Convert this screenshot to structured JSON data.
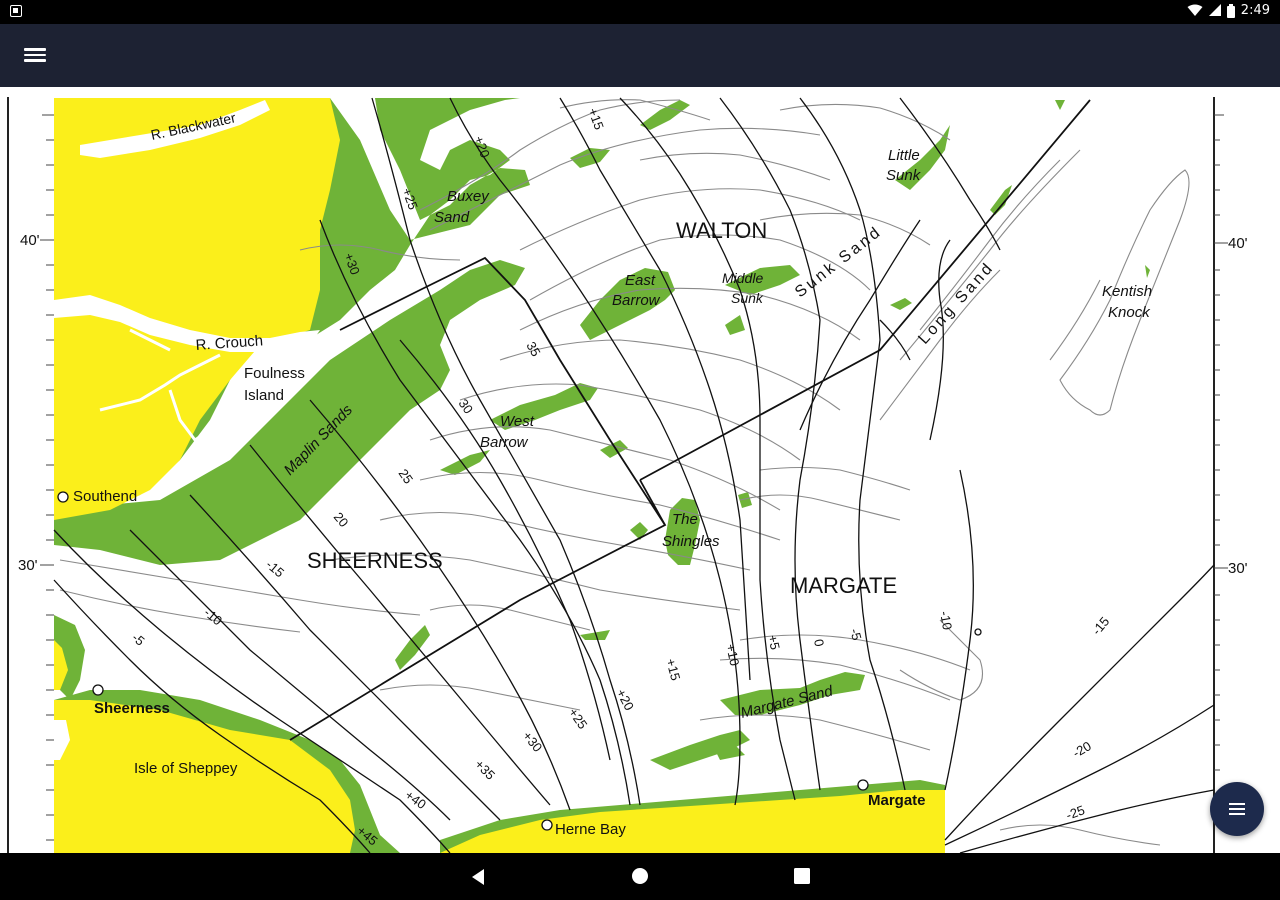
{
  "status_bar": {
    "time": "2:49",
    "icons": [
      "app-notification-icon",
      "wifi-icon",
      "cell-signal-icon",
      "battery-icon"
    ]
  },
  "toolbar": {
    "menu_icon": "hamburger-menu-icon"
  },
  "map": {
    "regions": {
      "sheerness": "SHEERNESS",
      "margate": "MARGATE",
      "walton": "WALTON"
    },
    "places": {
      "southend": "Southend",
      "sheerness": "Sheerness",
      "herne_bay": "Herne Bay",
      "margate": "Margate",
      "foulness_1": "Foulness",
      "foulness_2": "Island",
      "isle_of_sheppey": "Isle of Sheppey"
    },
    "rivers": {
      "blackwater": "R. Blackwater",
      "crouch": "R. Crouch"
    },
    "sands": {
      "buxey_1": "Buxey",
      "buxey_2": "Sand",
      "east_barrow_1": "East",
      "east_barrow_2": "Barrow",
      "middle_sunk_1": "Middle",
      "middle_sunk_2": "Sunk",
      "little_sunk_1": "Little",
      "little_sunk_2": "Sunk",
      "sunk_sand": "Sunk Sand",
      "long_sand": "Long Sand",
      "kentish_knock_1": "Kentish",
      "kentish_knock_2": "Knock",
      "maplin": "Maplin Sands",
      "west_barrow_1": "West",
      "west_barrow_2": "Barrow",
      "shingles_1": "The",
      "shingles_2": "Shingles",
      "margate_sand": "Margate Sand"
    },
    "latitude_ticks": {
      "left_40": "40'",
      "left_30": "30'",
      "right_40": "40'",
      "right_30": "30'"
    },
    "contour_labels": {
      "p15": "+15",
      "p20": "+20",
      "p25": "+25",
      "p30": "+30",
      "p35": "+35",
      "n35": "35",
      "n30": "30",
      "n25": "25",
      "n20": "20",
      "m15": "-15",
      "m10": "-10",
      "m5": "-5",
      "s40": "+40",
      "s45": "+45",
      "s35": "+35",
      "s30": "+30",
      "s25": "+25",
      "s20": "+20",
      "s15": "+15",
      "s10": "+10",
      "s5": "+5",
      "z0": "0",
      "z5": "-5",
      "z10": "-10",
      "e15": "-15",
      "e20": "-20",
      "e25": "-25"
    },
    "colors": {
      "land": "#fbef1b",
      "sandbank": "#6fb338",
      "water": "#ffffff",
      "contour": "#8a8a8a",
      "line": "#111111"
    }
  },
  "fab": {
    "icon": "list-icon"
  },
  "nav_bar": {
    "back": "back-icon",
    "home": "home-icon",
    "recents": "recents-icon"
  }
}
